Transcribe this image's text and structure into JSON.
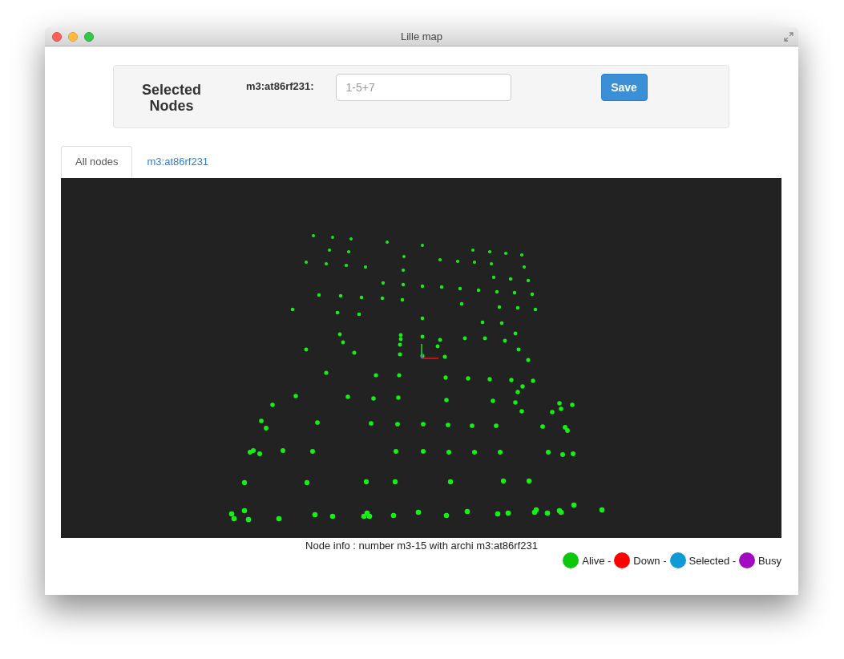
{
  "window": {
    "title": "Lille map"
  },
  "selection_panel": {
    "heading": "Selected Nodes",
    "field_label": "m3:at86rf231:",
    "placeholder": "1-5+7",
    "save_button": "Save"
  },
  "tabs": [
    {
      "label": "All nodes",
      "selected": true
    },
    {
      "label": "m3:at86rf231",
      "selected": false
    }
  ],
  "node_info": "Node info : number m3-15 with archi m3:at86rf231",
  "legend": [
    {
      "label": "Alive -",
      "color": "#0cc80c"
    },
    {
      "label": "Down -",
      "color": "#ff0000"
    },
    {
      "label": "Selected -",
      "color": "#0e9ad4"
    },
    {
      "label": "Busy",
      "color": "#a20cc0"
    }
  ]
}
